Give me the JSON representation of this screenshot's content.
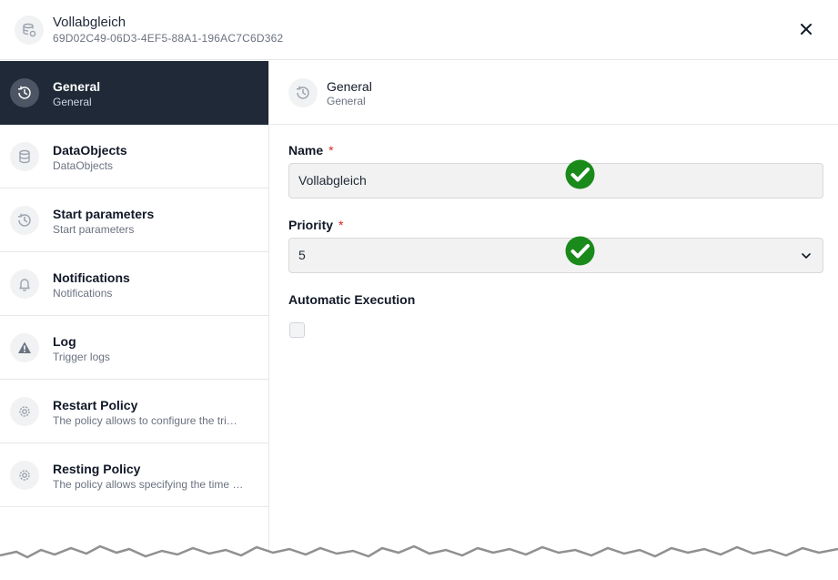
{
  "header": {
    "title": "Vollabgleich",
    "id": "69D02C49-06D3-4EF5-88A1-196AC7C6D362",
    "icon": "database-gear-icon"
  },
  "sidebar": {
    "items": [
      {
        "label": "General",
        "sub": "General",
        "icon": "clock-history-icon",
        "active": true
      },
      {
        "label": "DataObjects",
        "sub": "DataObjects",
        "icon": "database-icon"
      },
      {
        "label": "Start parameters",
        "sub": "Start parameters",
        "icon": "clock-history-icon"
      },
      {
        "label": "Notifications",
        "sub": "Notifications",
        "icon": "bell-icon"
      },
      {
        "label": "Log",
        "sub": "Trigger logs",
        "icon": "warning-icon"
      },
      {
        "label": "Restart Policy",
        "sub": "The policy allows to configure the tri…",
        "icon": "gear-icon"
      },
      {
        "label": "Resting Policy",
        "sub": "The policy allows specifying the time …",
        "icon": "gear-icon"
      }
    ]
  },
  "main": {
    "title": "General",
    "subtitle": "General",
    "fields": {
      "name": {
        "label": "Name",
        "required": "*",
        "value": "Vollabgleich"
      },
      "priority": {
        "label": "Priority",
        "required": "*",
        "value": "5"
      },
      "automatic_execution": {
        "label": "Automatic Execution",
        "checked": false
      }
    }
  },
  "colors": {
    "active_bg": "#1f2937",
    "required": "#dc2626",
    "check_badge": "#1a8a1a"
  }
}
